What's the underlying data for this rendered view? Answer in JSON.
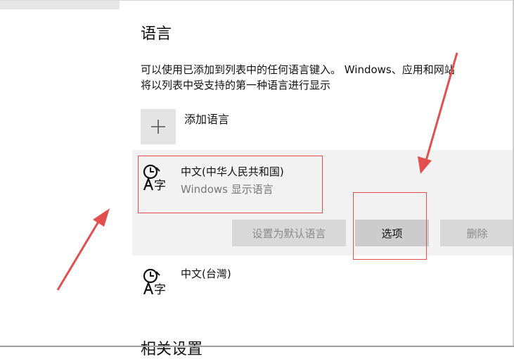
{
  "section_title": "语言",
  "description_line1": "可以使用已添加到列表中的任何语言键入。 Windows、应用和网站",
  "description_line2": "将以列表中受支持的第一种语言进行显示",
  "add_language": {
    "label": "添加语言"
  },
  "languages": [
    {
      "name": "中文(中华人民共和国)",
      "subtitle": "Windows 显示语言",
      "selected": true
    },
    {
      "name": "中文(台灣)",
      "subtitle": "",
      "selected": false
    }
  ],
  "actions": {
    "set_default": "设置为默认语言",
    "options": "选项",
    "remove": "删除"
  },
  "related_settings_title": "相关设置",
  "colors": {
    "annotation_red": "#e34f4f",
    "selected_bg": "#f2f2f2",
    "disabled_text": "#8a8a8a"
  },
  "icons": [
    "plus-icon",
    "language-icon",
    "annotation-arrow"
  ]
}
